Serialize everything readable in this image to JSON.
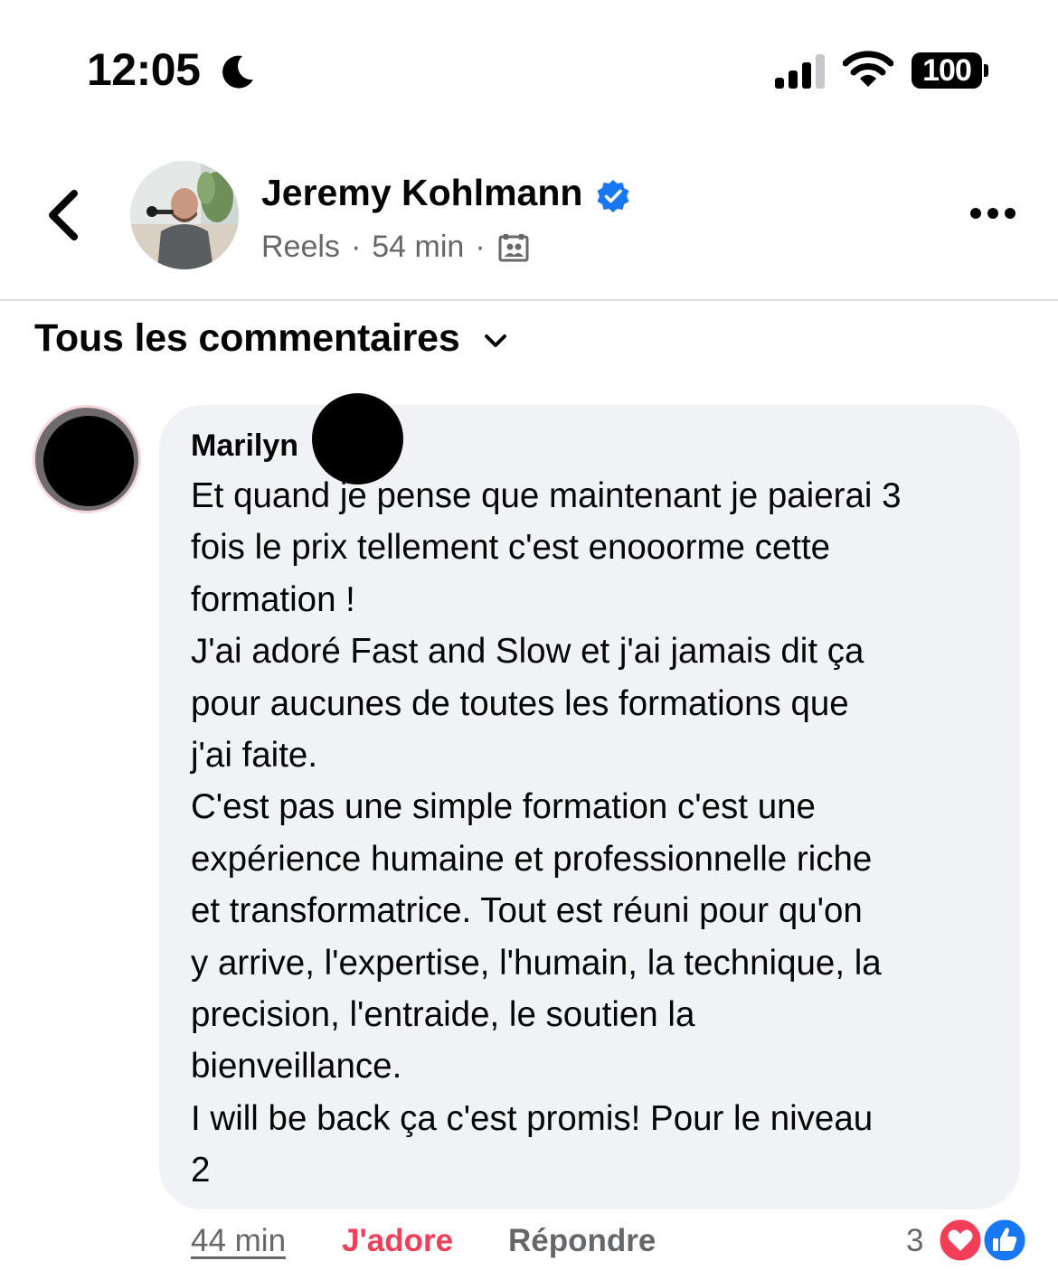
{
  "status_bar": {
    "time": "12:05",
    "battery": "100",
    "icons": [
      "moon-icon",
      "signal-icon",
      "wifi-icon",
      "battery-icon"
    ]
  },
  "header": {
    "author_name": "Jeremy Kohlmann",
    "verified": true,
    "meta": {
      "source": "Reels",
      "separator": "·",
      "age": "54 min"
    },
    "icons": [
      "back-arrow-icon",
      "verified-badge-icon",
      "audience-icon",
      "more-icon"
    ]
  },
  "filter": {
    "label": "Tous les commentaires"
  },
  "comment": {
    "author": "Marilyn",
    "lines": [
      "Et quand je pense que maintenant je paierai 3",
      "fois le prix tellement c'est enooorme cette",
      "formation !",
      "J'ai adoré Fast and Slow et j'ai jamais dit ça",
      "pour aucunes de toutes les formations que",
      "j'ai faite.",
      "C'est pas une simple formation c'est une",
      "expérience humaine et professionnelle riche",
      "et transformatrice. Tout est réuni pour qu'on",
      "y arrive, l'expertise, l'humain, la technique, la",
      "precision, l'entraide, le soutien  la",
      "bienveillance.",
      "I will be back ça c'est promis! Pour le niveau",
      "2"
    ],
    "time": "44 min",
    "love_label": "J'adore",
    "reply_label": "Répondre",
    "reaction_count": "3",
    "reactions": [
      "heart-icon",
      "like-icon"
    ]
  },
  "colors": {
    "accent_blue": "#1877f2",
    "love_red": "#f33e58",
    "secondary_text": "#65676b",
    "bubble_bg": "#f0f2f5"
  }
}
